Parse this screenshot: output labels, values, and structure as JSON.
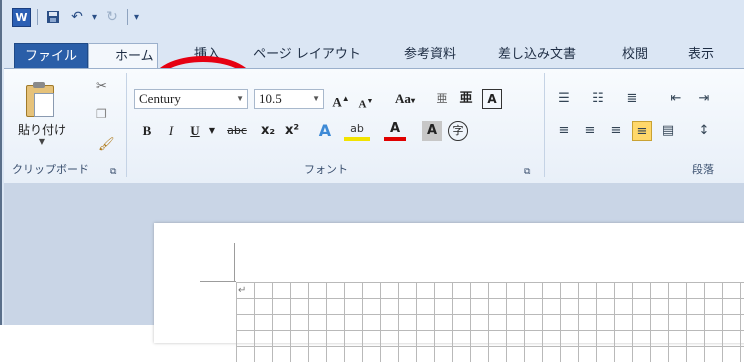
{
  "window": {
    "app_icon_letter": "W"
  },
  "tabs": {
    "file": "ファイル",
    "home": "ホーム",
    "insert": "挿入",
    "page_layout": "ページ レイアウト",
    "references": "参考資料",
    "mailings": "差し込み文書",
    "review": "校閲",
    "view": "表示"
  },
  "clipboard": {
    "paste_label": "貼り付け",
    "group_label": "クリップボード"
  },
  "font": {
    "name": "Century",
    "size": "10.5",
    "group_label": "フォント",
    "grow_label": "A",
    "shrink_label": "A",
    "case_label": "Aa",
    "bold": "B",
    "italic": "I",
    "underline": "U",
    "strike": "abc",
    "subscript": "x₂",
    "superscript": "x²",
    "color_label": "A",
    "shade_label": "A",
    "enclose_label": "字"
  },
  "paragraph": {
    "group_label": "段落"
  },
  "icons": {
    "highlight_circle_color": "#e60012",
    "file_tab_color": "#2a5ea8"
  }
}
